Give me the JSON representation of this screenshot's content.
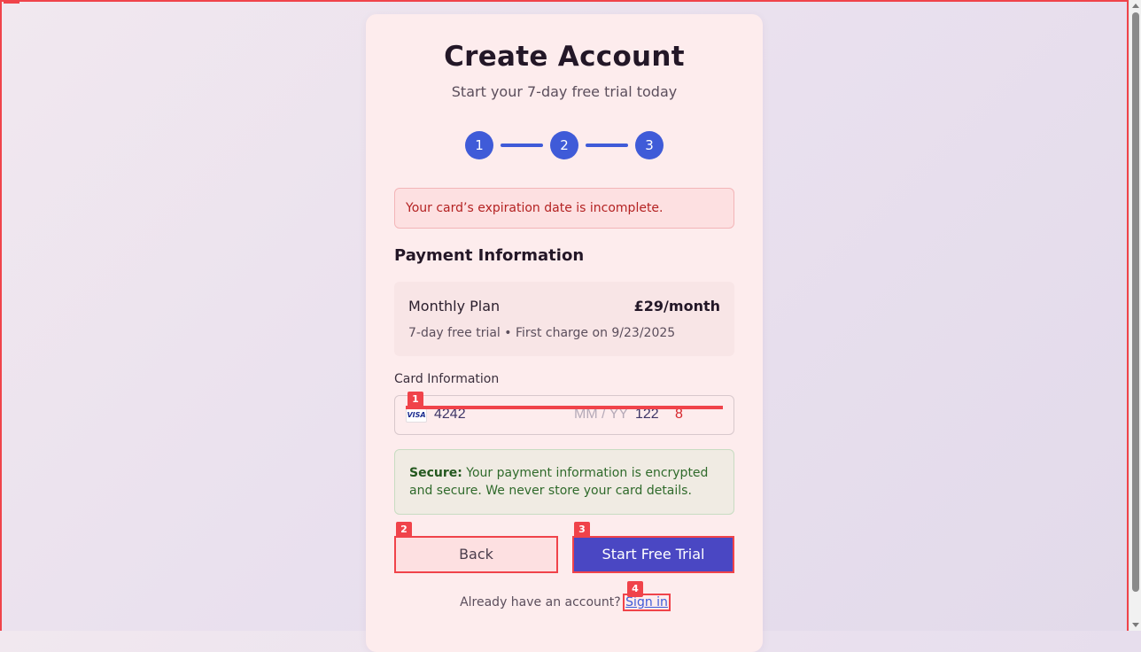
{
  "header": {
    "title": "Create Account",
    "subtitle": "Start your 7-day free trial today"
  },
  "steps": [
    "1",
    "2",
    "3"
  ],
  "alert": {
    "message": "Your card’s expiration date is incomplete."
  },
  "payment": {
    "section_title": "Payment Information",
    "plan_name": "Monthly Plan",
    "plan_price": "£29/month",
    "plan_note": "7-day free trial • First charge on 9/23/2025"
  },
  "card_field": {
    "label": "Card Information",
    "brand": "VISA",
    "number": "4242",
    "expiry_placeholder": "MM / YY",
    "cvc": "122",
    "zip": "8"
  },
  "secure": {
    "strong": "Secure:",
    "text": " Your payment information is encrypted and secure. We never store your card details."
  },
  "buttons": {
    "back": "Back",
    "start": "Start Free Trial"
  },
  "footer": {
    "prompt": "Already have an account?",
    "sign_in": "Sign in"
  },
  "badges": [
    "1",
    "2",
    "3",
    "4"
  ],
  "colors": {
    "primary": "#3f5bd8",
    "button_primary": "#4a47c3",
    "error": "#b42222",
    "success": "#2f6a2b",
    "marker": "#f0434a"
  }
}
